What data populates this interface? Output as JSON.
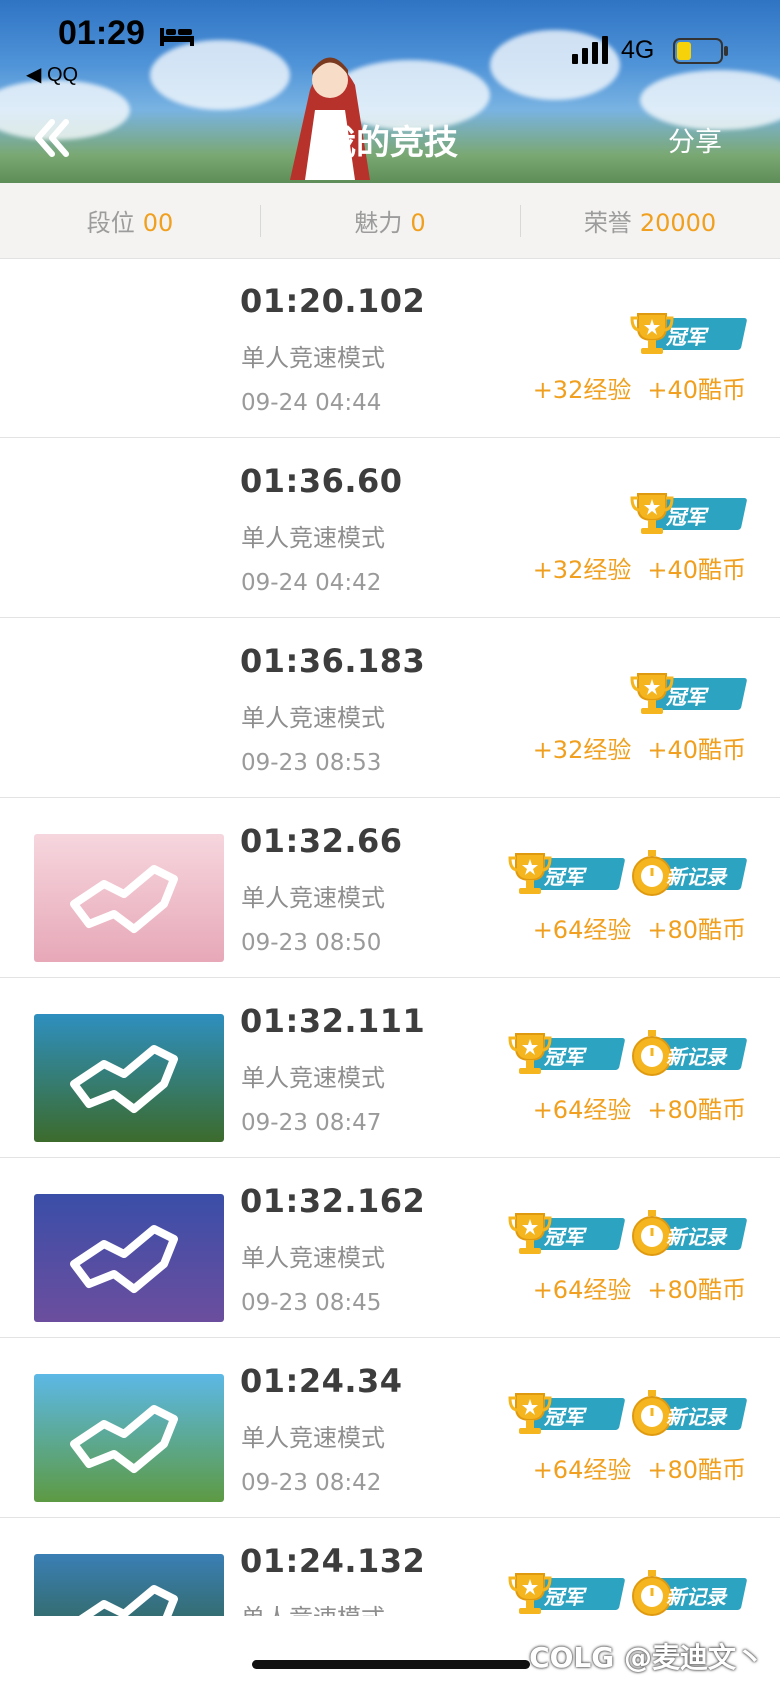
{
  "status_bar": {
    "time": "01:29",
    "back_app": "◀ QQ",
    "network": "4G"
  },
  "header": {
    "title": "我的竞技",
    "share": "分享"
  },
  "stats": [
    {
      "label": "段位",
      "value": "00"
    },
    {
      "label": "魅力",
      "value": "0"
    },
    {
      "label": "荣誉",
      "value": "20000"
    }
  ],
  "badge_text": {
    "champion": "冠军",
    "new_record": "新记录"
  },
  "races": [
    {
      "time": "01:20.102",
      "mode": "单人竞速模式",
      "date": "09-24 04:44",
      "exp": "+32经验",
      "coins": "+40酷币",
      "new_record": false,
      "has_thumb": false
    },
    {
      "time": "01:36.60",
      "mode": "单人竞速模式",
      "date": "09-24 04:42",
      "exp": "+32经验",
      "coins": "+40酷币",
      "new_record": false,
      "has_thumb": false
    },
    {
      "time": "01:36.183",
      "mode": "单人竞速模式",
      "date": "09-23 08:53",
      "exp": "+32经验",
      "coins": "+40酷币",
      "new_record": false,
      "has_thumb": false
    },
    {
      "time": "01:32.66",
      "mode": "单人竞速模式",
      "date": "09-23 08:50",
      "exp": "+64经验",
      "coins": "+80酷币",
      "new_record": true,
      "has_thumb": true,
      "thumb_colors": [
        "#f6d6de",
        "#e7a8b8"
      ]
    },
    {
      "time": "01:32.111",
      "mode": "单人竞速模式",
      "date": "09-23 08:47",
      "exp": "+64经验",
      "coins": "+80酷币",
      "new_record": true,
      "has_thumb": true,
      "thumb_colors": [
        "#2e8fbf",
        "#3c6b2c"
      ]
    },
    {
      "time": "01:32.162",
      "mode": "单人竞速模式",
      "date": "09-23 08:45",
      "exp": "+64经验",
      "coins": "+80酷币",
      "new_record": true,
      "has_thumb": true,
      "thumb_colors": [
        "#3a4ea8",
        "#6c4e9e"
      ]
    },
    {
      "time": "01:24.34",
      "mode": "单人竞速模式",
      "date": "09-23 08:42",
      "exp": "+64经验",
      "coins": "+80酷币",
      "new_record": true,
      "has_thumb": true,
      "thumb_colors": [
        "#5cb8e6",
        "#5d9a43"
      ]
    },
    {
      "time": "01:24.132",
      "mode": "单人竞速模式",
      "date": "",
      "exp": "",
      "coins": "",
      "new_record": true,
      "has_thumb": true,
      "thumb_colors": [
        "#3a7fb5",
        "#2e5a2c"
      ]
    }
  ],
  "watermark": "COLG @麦迪文丶",
  "colors": {
    "accent": "#f0a01e",
    "badge_teal": "#2ca3c1"
  }
}
